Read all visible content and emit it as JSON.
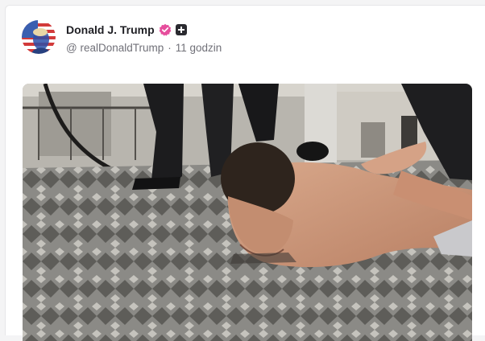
{
  "post": {
    "author": {
      "display_name": "Donald J. Trump",
      "handle": "@ realDonaldTrump",
      "time_ago": "11 godzin",
      "separator": "·",
      "verified_icon": "verified-badge-icon",
      "plus_icon": "plus-badge-icon"
    },
    "media": {
      "type": "photo",
      "alt_icon": "attached-photo"
    }
  },
  "colors": {
    "verified": "#e64d9c",
    "text_primary": "#1f1f24",
    "text_secondary": "#707078",
    "card_bg": "#ffffff",
    "page_bg": "#f4f4f5"
  }
}
